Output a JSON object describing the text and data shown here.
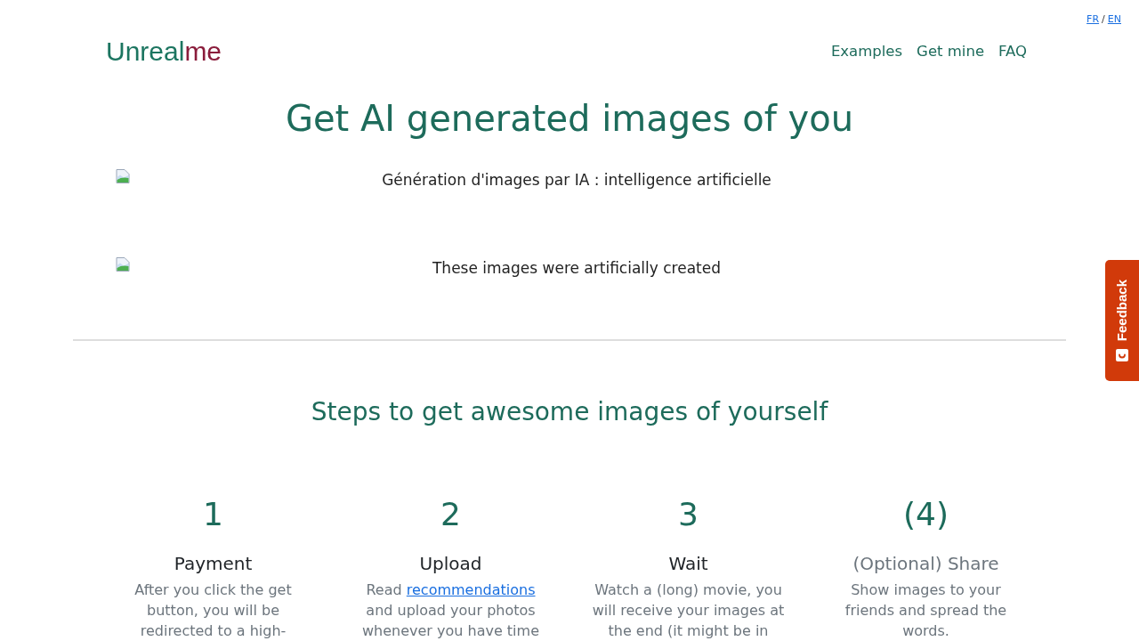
{
  "language_switch": {
    "links": [
      "FR",
      "EN"
    ],
    "separator": "/"
  },
  "header": {
    "logo": [
      "Unreal",
      "me"
    ],
    "nav": [
      "Examples",
      "Get mine",
      "FAQ"
    ]
  },
  "hero": {
    "title": "Get AI generated images of you",
    "images": [
      {
        "alt": "Génération d'images par IA : intelligence artificielle"
      },
      {
        "alt": "These images were artificially created"
      }
    ]
  },
  "steps_section": {
    "title": "Steps to get awesome images of yourself",
    "steps": [
      {
        "number": "1",
        "title": "Payment",
        "optional": false,
        "description": [
          {
            "kind": "text",
            "text": "After you click the get button, you will be redirected to a high-"
          }
        ]
      },
      {
        "number": "2",
        "title": "Upload",
        "optional": false,
        "description": [
          {
            "kind": "text",
            "text": "Read"
          },
          {
            "kind": "link",
            "text": "recommendations"
          },
          {
            "kind": "text",
            "text": "and upload your photos whenever you have time"
          }
        ]
      },
      {
        "number": "3",
        "title": "Wait",
        "optional": false,
        "description": [
          {
            "kind": "text",
            "text": "Watch a (long) movie, you will receive your images at the end (it might be in"
          }
        ]
      },
      {
        "number": "(4)",
        "title": "(Optional) Share",
        "optional": true,
        "description": [
          {
            "kind": "text",
            "text": "Show images to your friends and spread the words."
          }
        ]
      }
    ]
  },
  "feedback_tab": {
    "label": "Feedback"
  }
}
